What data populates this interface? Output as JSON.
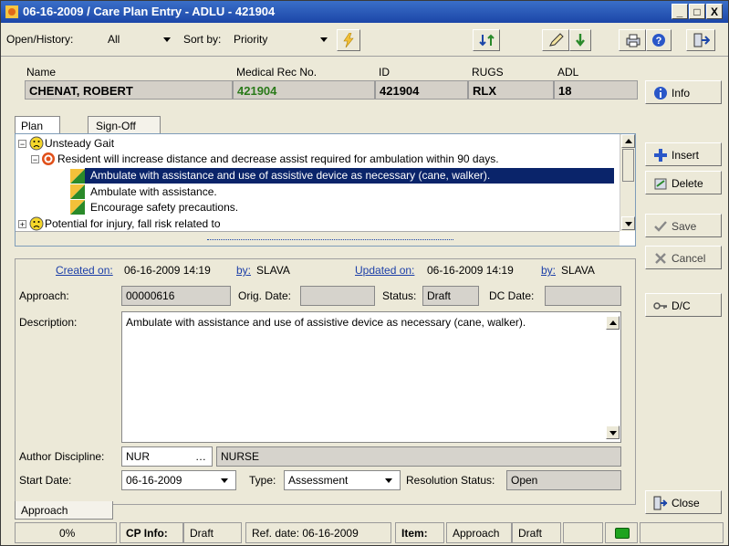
{
  "window": {
    "title": "06-16-2009 / Care Plan Entry - ADLU - 421904",
    "min": "_",
    "max": "□",
    "close": "X"
  },
  "toolbar": {
    "open_history_label": "Open/History:",
    "open_history_value": "All",
    "sort_by_label": "Sort by:",
    "sort_by_value": "Priority"
  },
  "header": {
    "name_label": "Name",
    "name_value": "CHENAT, ROBERT",
    "mrn_label": "Medical Rec No.",
    "mrn_value": "421904",
    "id_label": "ID",
    "id_value": "421904",
    "rugs_label": "RUGS",
    "rugs_value": "RLX",
    "adl_label": "ADL",
    "adl_value": "18",
    "info_button": "Info"
  },
  "tabs": {
    "plan": "Plan",
    "signoff": "Sign-Off"
  },
  "tree": {
    "items": [
      "Unsteady Gait",
      "Resident will increase distance and decrease assist required for ambulation within 90 days.",
      "Ambulate with assistance and use of assistive device as necessary (cane, walker).",
      "Ambulate with assistance.",
      "Encourage safety precautions.",
      "Potential for injury, fall risk related to"
    ]
  },
  "side_buttons": {
    "insert": "Insert",
    "delete": "Delete",
    "save": "Save",
    "cancel": "Cancel",
    "dc": "D/C",
    "close": "Close"
  },
  "detail": {
    "created_on_label": "Created on:",
    "created_on_value": "06-16-2009 14:19",
    "created_by_label": "by:",
    "created_by_value": "SLAVA",
    "updated_on_label": "Updated on:",
    "updated_on_value": "06-16-2009 14:19",
    "updated_by_label": "by:",
    "updated_by_value": "SLAVA",
    "approach_label": "Approach:",
    "approach_value": "00000616",
    "orig_date_label": "Orig. Date:",
    "status_label": "Status:",
    "status_value": "Draft",
    "dc_date_label": "DC Date:",
    "description_label": "Description:",
    "description_value": "Ambulate with assistance and use of assistive device as necessary (cane, walker).",
    "author_discipline_label": "Author Discipline:",
    "author_discipline_code": "NUR",
    "author_discipline_ellipsis": "…",
    "author_discipline_name": "NURSE",
    "start_date_label": "Start Date:",
    "start_date_value": "06-16-2009",
    "type_label": "Type:",
    "type_value": "Assessment",
    "resolution_status_label": "Resolution Status:",
    "resolution_status_value": "Open",
    "approach_tab": "Approach"
  },
  "statusbar": {
    "progress": "0%",
    "cp_info_label": "CP Info:",
    "cp_info_value": "Draft",
    "ref_date": "Ref. date: 06-16-2009",
    "item_label": "Item:",
    "item_value": "Approach",
    "item_status": "Draft"
  },
  "colors": {
    "title_bar": "#1c46a8",
    "selected_row": "#0a246a",
    "mrn_green": "#2a7a1a",
    "status_led": "#1fa31f"
  }
}
